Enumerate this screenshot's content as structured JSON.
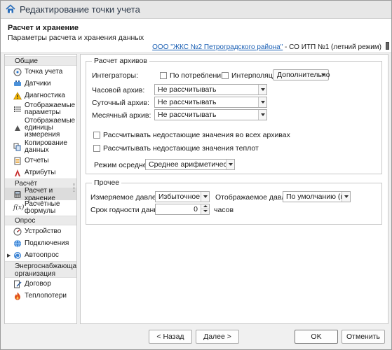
{
  "window": {
    "title": "Редактирование точки учета"
  },
  "header": {
    "title": "Расчет и хранение",
    "subtitle": "Параметры расчета и хранения данных",
    "link": "ООО \"ЖКС №2 Петроградского района\"",
    "suffix": " - СО ИТП №1 (летний режим)"
  },
  "sidebar": {
    "groups": [
      {
        "label": "Общие",
        "items": [
          "Точка учета",
          "Датчики",
          "Диагностика",
          "Отображаемые параметры",
          "Отображаемые единицы измерения",
          "Копирование данных",
          "Отчеты",
          "Атрибуты"
        ]
      },
      {
        "label": "Расчёт",
        "items": [
          "Расчет и хранение",
          "Расчётные формулы"
        ]
      },
      {
        "label": "Опрос",
        "items": [
          "Устройство",
          "Подключения",
          "Автоопрос"
        ]
      },
      {
        "label": "Энергоснабжающая организация",
        "items": [
          "Договор",
          "Теплопотери"
        ]
      }
    ]
  },
  "archives": {
    "legend": "Расчет архивов",
    "integrators_label": "Интеграторы:",
    "by_consumption": "По потреблению",
    "interpolation": "Интерполяция",
    "additional": "Дополнительно",
    "hourly_label": "Часовой архив:",
    "hourly_value": "Не рассчитывать",
    "daily_label": "Суточный архив:",
    "daily_value": "Не рассчитывать",
    "monthly_label": "Месячный архив:",
    "monthly_value": "Не рассчитывать",
    "calc_missing_all": "Рассчитывать недостающие значения во всех архивах",
    "calc_missing_heat": "Рассчитывать недостающие значения теплот",
    "averaging_label": "Режим осреднения:",
    "averaging_value": "Среднее арифметическое"
  },
  "other": {
    "legend": "Прочее",
    "measured_pressure_label": "Измеряемое давление:",
    "measured_pressure_value": "Избыточное",
    "displayed_pressure_label": "Отображаемое давление:",
    "displayed_pressure_value": "По умолчанию (из с...",
    "validity_label": "Срок годности данных:",
    "validity_value": "0",
    "validity_unit": "часов"
  },
  "footer": {
    "back": "< Назад",
    "next": "Далее >",
    "ok": "OK",
    "cancel": "Отменить"
  }
}
